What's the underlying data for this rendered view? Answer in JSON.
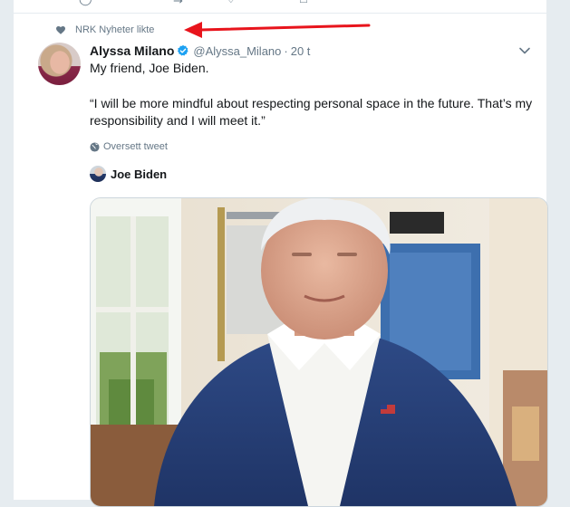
{
  "context": {
    "liked_by": "NRK Nyheter likte"
  },
  "tweet": {
    "author_name": "Alyssa Milano",
    "handle": "@Alyssa_Milano",
    "separator": "·",
    "time": "20 t",
    "text_line1": "My friend, Joe Biden.",
    "quote": "“I will be more mindful about respecting personal space in the future. That’s my responsibility and I will meet it.”",
    "translate_label": "Oversett tweet",
    "media_author": "Joe Biden"
  },
  "icons": {
    "context": "heart-icon",
    "verified": "verified-badge-icon",
    "menu": "chevron-down-icon",
    "translate": "globe-icon",
    "annotation": "red-arrow"
  },
  "colors": {
    "verified": "#1da1f2",
    "secondary_text": "#657786",
    "arrow": "#e8141c"
  }
}
